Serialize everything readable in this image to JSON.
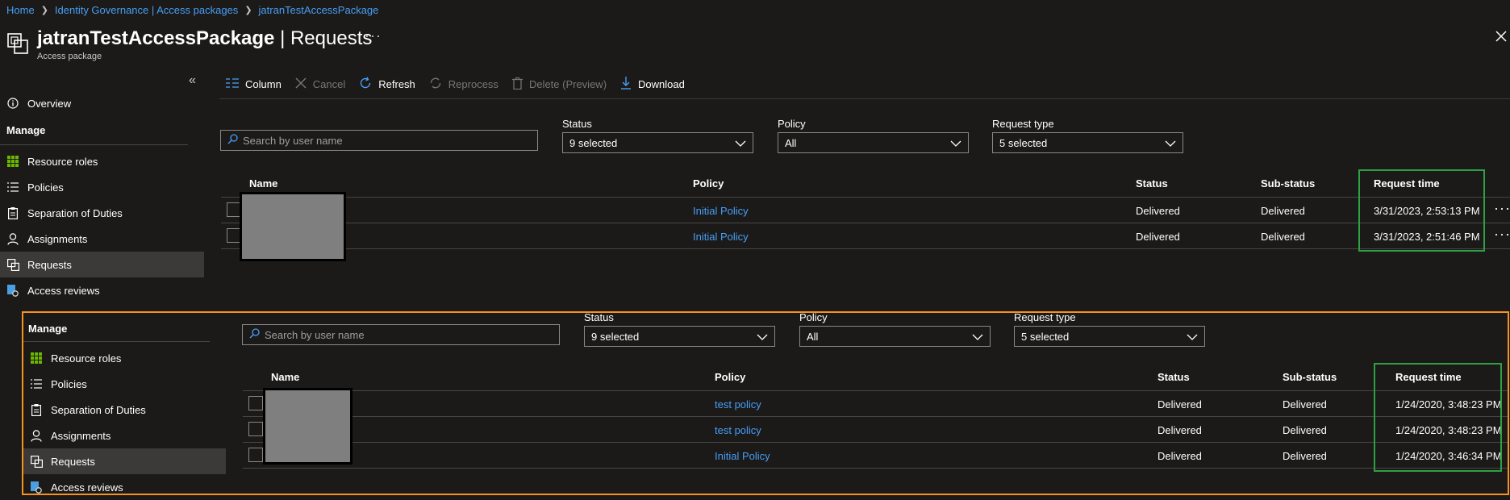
{
  "breadcrumb": [
    "Home",
    "Identity Governance | Access packages",
    "jatranTestAccessPackage"
  ],
  "header": {
    "title_name": "jatranTestAccessPackage",
    "title_sep": " | Requests",
    "subtitle": "Access package",
    "more": "···"
  },
  "sidebar": {
    "overview": "Overview",
    "manage": "Manage",
    "items": [
      {
        "label": "Resource roles",
        "icon": "grid-icon"
      },
      {
        "label": "Policies",
        "icon": "list-icon"
      },
      {
        "label": "Separation of Duties",
        "icon": "clipboard-icon"
      },
      {
        "label": "Assignments",
        "icon": "person-icon"
      },
      {
        "label": "Requests",
        "icon": "requests-icon"
      },
      {
        "label": "Access reviews",
        "icon": "review-icon"
      }
    ],
    "active": "Requests"
  },
  "toolbar": {
    "column": "Column",
    "cancel": "Cancel",
    "refresh": "Refresh",
    "reprocess": "Reprocess",
    "delete": "Delete (Preview)",
    "download": "Download"
  },
  "filters": {
    "search_placeholder": "Search by user name",
    "status_label": "Status",
    "status_value": "9 selected",
    "policy_label": "Policy",
    "policy_value": "All",
    "request_type_label": "Request type",
    "request_type_value": "5 selected"
  },
  "columns": [
    "Name",
    "Policy",
    "Status",
    "Sub-status",
    "Request time"
  ],
  "table_top": [
    {
      "policy": "Initial Policy",
      "status": "Delivered",
      "substatus": "Delivered",
      "time": "3/31/2023, 2:53:13 PM"
    },
    {
      "policy": "Initial Policy",
      "status": "Delivered",
      "substatus": "Delivered",
      "time": "3/31/2023, 2:51:46 PM"
    }
  ],
  "table_bottom": [
    {
      "policy": "test policy",
      "status": "Delivered",
      "substatus": "Delivered",
      "time": "1/24/2020, 3:48:23 PM"
    },
    {
      "policy": "test policy",
      "status": "Delivered",
      "substatus": "Delivered",
      "time": "1/24/2020, 3:48:23 PM"
    },
    {
      "policy": "Initial Policy",
      "status": "Delivered",
      "substatus": "Delivered",
      "time": "1/24/2020, 3:46:34 PM"
    }
  ],
  "row_more": "···",
  "colors": {
    "background": "#1b1a19",
    "link": "#479ef5",
    "highlight_green": "#2ea043",
    "highlight_orange": "#f7921e",
    "active_nav": "#3b3a39"
  }
}
